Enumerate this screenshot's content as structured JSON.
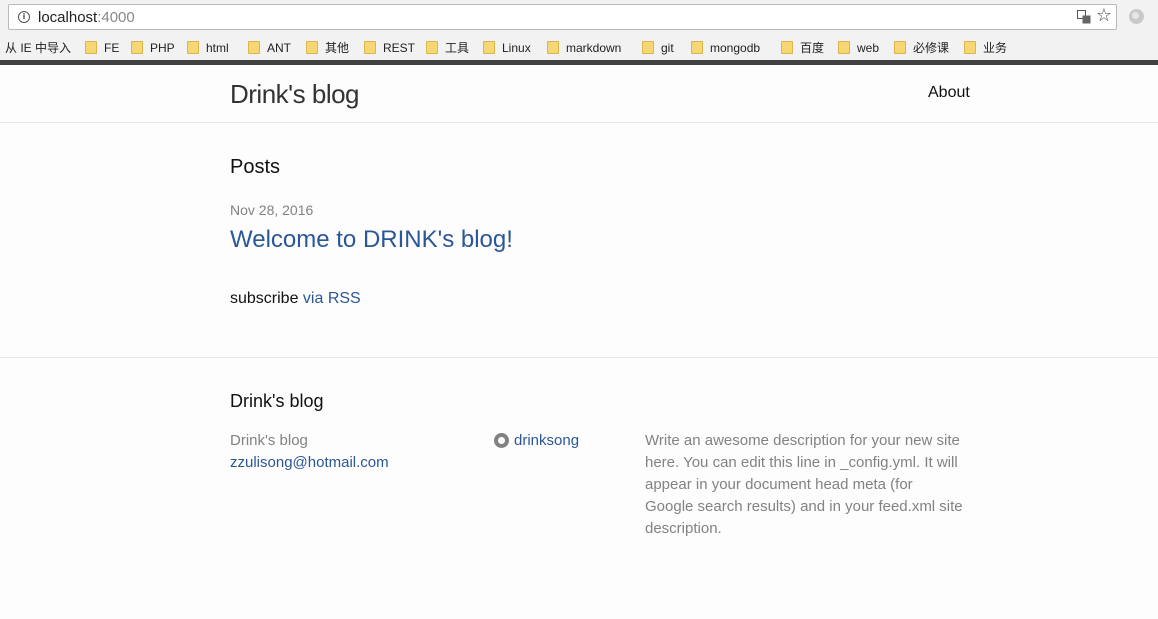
{
  "browser": {
    "url_host": "localhost",
    "url_port": ":4000",
    "bookmarks": [
      "从 IE 中导入",
      "FE",
      "PHP",
      "html",
      "ANT",
      "其他",
      "REST",
      "工具",
      "Linux",
      "markdown",
      "git",
      "mongodb",
      "百度",
      "web",
      "必修课",
      "业务"
    ]
  },
  "header": {
    "site_title": "Drink's blog",
    "nav_about": "About"
  },
  "main": {
    "heading": "Posts",
    "post": {
      "date": "Nov 28, 2016",
      "title": "Welcome to DRINK's blog!"
    },
    "subscribe_text": "subscribe ",
    "subscribe_link": "via RSS"
  },
  "footer": {
    "heading": "Drink's blog",
    "name": "Drink's blog",
    "email": "zzulisong@hotmail.com",
    "github": "drinksong",
    "description": "Write an awesome description for your new site here. You can edit this line in _config.yml. It will appear in your document head meta (for Google search results) and in your feed.xml site description."
  },
  "colors": {
    "link": "#2b5797",
    "muted": "#828282",
    "strip": "#424242"
  }
}
